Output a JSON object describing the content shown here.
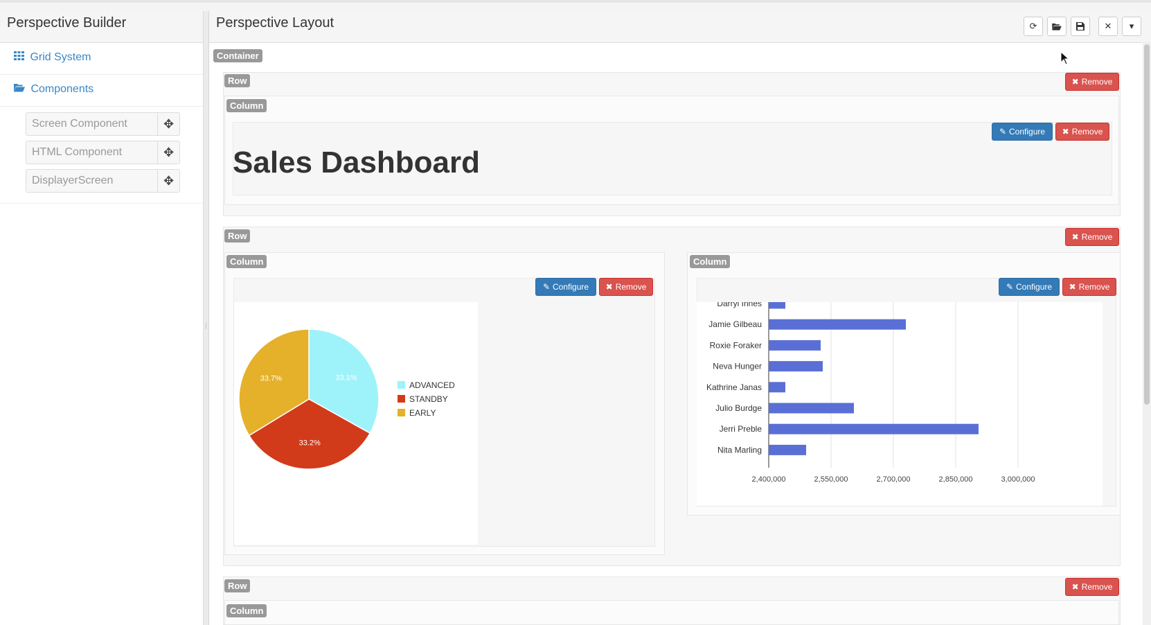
{
  "sidebar": {
    "title": "Perspective Builder",
    "sections": [
      {
        "label": "Grid System",
        "icon": "grid-icon"
      },
      {
        "label": "Components",
        "icon": "folder-open-icon"
      }
    ],
    "components": [
      {
        "label": "Screen Component"
      },
      {
        "label": "HTML Component"
      },
      {
        "label": "DisplayerScreen"
      }
    ]
  },
  "main": {
    "title": "Perspective Layout",
    "toolbar": [
      {
        "name": "refresh-icon",
        "glyph": "⟳"
      },
      {
        "name": "folder-open-icon",
        "glyph": "▰"
      },
      {
        "name": "save-icon",
        "glyph": "▣"
      },
      {
        "name": "close-icon",
        "glyph": "✕"
      },
      {
        "name": "caret-down-icon",
        "glyph": "▾"
      }
    ],
    "labels": {
      "container": "Container",
      "row": "Row",
      "column": "Column",
      "configure": "Configure",
      "remove": "Remove"
    },
    "dashboard_title": "Sales Dashboard"
  },
  "chart_data": [
    {
      "type": "pie",
      "slices": [
        {
          "label": "ADVANCED",
          "value": 33.1,
          "display": "33.1%",
          "color": "#9ef3fb"
        },
        {
          "label": "STANDBY",
          "value": 33.2,
          "display": "33.2%",
          "color": "#d13b1a"
        },
        {
          "label": "EARLY",
          "value": 33.7,
          "display": "33.7%",
          "color": "#e5b12a"
        }
      ],
      "legend": "right"
    },
    {
      "type": "bar",
      "orientation": "horizontal",
      "categories": [
        "Darryl Innes",
        "Jamie Gilbeau",
        "Roxie Foraker",
        "Neva Hunger",
        "Kathrine Janas",
        "Julio Burdge",
        "Jerri Preble",
        "Nita Marling"
      ],
      "values": [
        2440000,
        2730000,
        2525000,
        2530000,
        2440000,
        2605000,
        2905000,
        2490000
      ],
      "xlim": [
        2400000,
        3050000
      ],
      "ticks": [
        2400000,
        2550000,
        2700000,
        2850000,
        3000000
      ],
      "tick_labels": [
        "2,400,000",
        "2,550,000",
        "2,700,000",
        "2,850,000",
        "3,000,000"
      ],
      "color": "#5a6fd6",
      "grid": true
    }
  ]
}
